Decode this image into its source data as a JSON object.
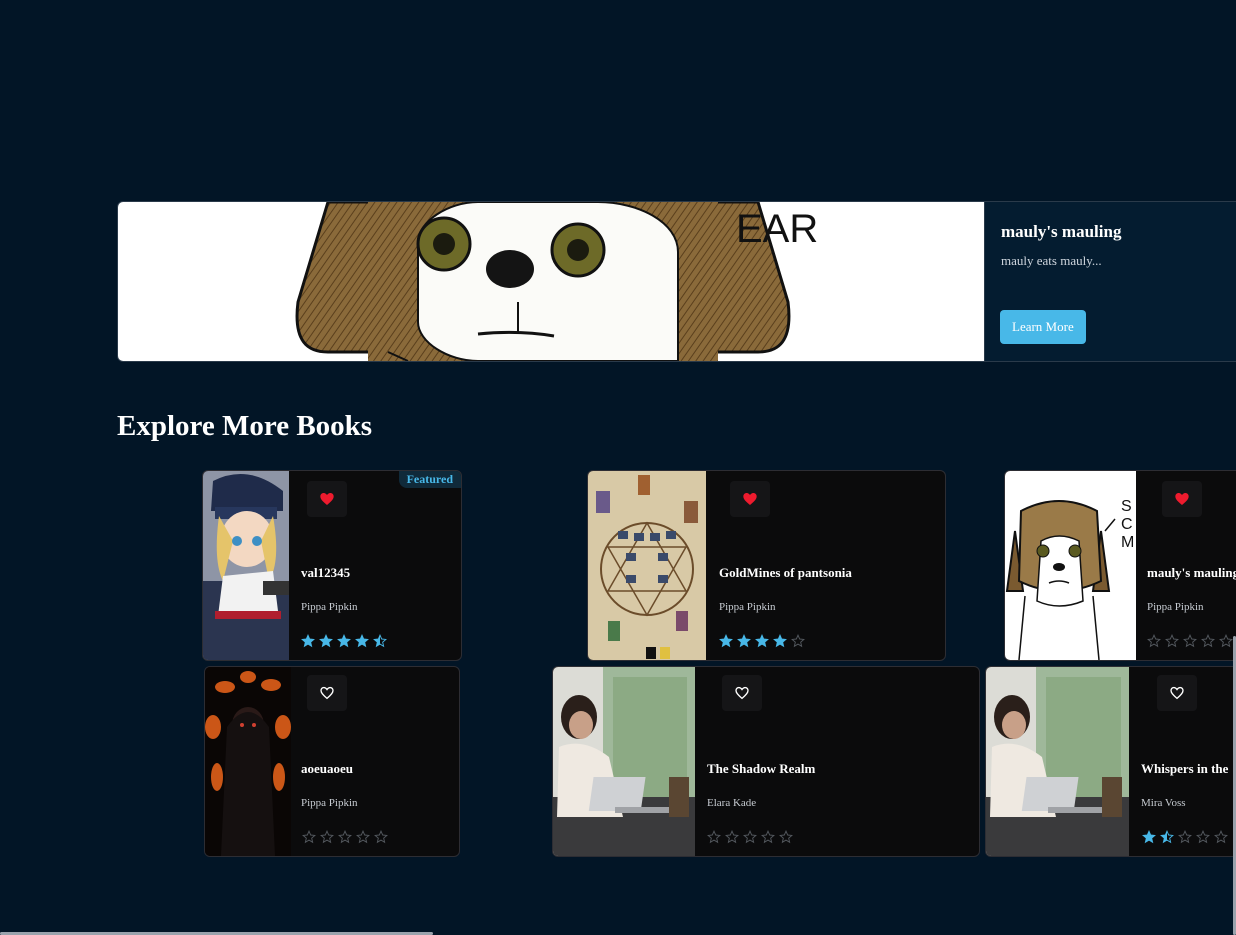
{
  "featured": {
    "art_text": "EAR",
    "title": "mauly's mauling",
    "description": "mauly eats mauly...",
    "button_label": "Learn More"
  },
  "section": {
    "title": "Explore More Books"
  },
  "books": [
    {
      "title": "val12345",
      "author": "Pippa Pipkin",
      "rating": 4.5,
      "favorited": true,
      "badge": "Featured"
    },
    {
      "title": "GoldMines of pantsonia",
      "author": "Pippa Pipkin",
      "rating": 4,
      "favorited": true
    },
    {
      "title": "mauly's mauling",
      "author": "Pippa Pipkin",
      "rating": 0,
      "favorited": true
    },
    {
      "title": "aoeuaoeu",
      "author": "Pippa Pipkin",
      "rating": 0,
      "favorited": false
    },
    {
      "title": "The Shadow Realm",
      "author": "Elara Kade",
      "rating": 0,
      "favorited": false
    },
    {
      "title": "Whispers in the",
      "author": "Mira Voss",
      "rating": 1.5,
      "favorited": false
    }
  ],
  "colors": {
    "background": "#021526",
    "accent": "#48b8e8",
    "heart": "#ee1b2e"
  },
  "icons": {
    "favorite": "heart-icon",
    "rating": "star-icon"
  }
}
